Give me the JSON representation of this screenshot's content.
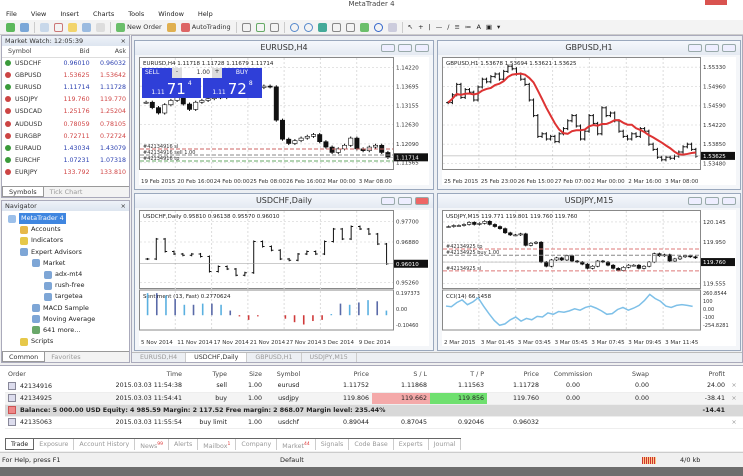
{
  "window": {
    "title": "MetaTrader 4"
  },
  "menu": [
    "File",
    "View",
    "Insert",
    "Charts",
    "Tools",
    "Window",
    "Help"
  ],
  "toolbar": {
    "new_order": "New Order",
    "autotrading": "AutoTrading"
  },
  "market_watch": {
    "title": "Market Watch: 12:05:39",
    "columns": [
      "Symbol",
      "Bid",
      "Ask"
    ],
    "rows": [
      {
        "symbol": "USDCHF",
        "bid": "0.96010",
        "ask": "0.96032",
        "dir": "up"
      },
      {
        "symbol": "GBPUSD",
        "bid": "1.53625",
        "ask": "1.53642",
        "dir": "dn"
      },
      {
        "symbol": "EURUSD",
        "bid": "1.11714",
        "ask": "1.11728",
        "dir": "up"
      },
      {
        "symbol": "USDJPY",
        "bid": "119.760",
        "ask": "119.770",
        "dir": "dn"
      },
      {
        "symbol": "USDCAD",
        "bid": "1.25176",
        "ask": "1.25204",
        "dir": "dn"
      },
      {
        "symbol": "AUDUSD",
        "bid": "0.78059",
        "ask": "0.78105",
        "dir": "dn"
      },
      {
        "symbol": "EURGBP",
        "bid": "0.72711",
        "ask": "0.72724",
        "dir": "dn"
      },
      {
        "symbol": "EURAUD",
        "bid": "1.43034",
        "ask": "1.43079",
        "dir": "up"
      },
      {
        "symbol": "EURCHF",
        "bid": "1.07231",
        "ask": "1.07318",
        "dir": "up"
      },
      {
        "symbol": "EURJPY",
        "bid": "133.792",
        "ask": "133.810",
        "dir": "dn"
      }
    ],
    "tabs": [
      "Symbols",
      "Tick Chart"
    ]
  },
  "navigator": {
    "title": "Navigator",
    "items": [
      {
        "label": "MetaTrader 4",
        "level": 0,
        "selected": true
      },
      {
        "label": "Accounts",
        "level": 1
      },
      {
        "label": "Indicators",
        "level": 1
      },
      {
        "label": "Expert Advisors",
        "level": 1
      },
      {
        "label": "Market",
        "level": 2
      },
      {
        "label": "adx-mt4",
        "level": 3
      },
      {
        "label": "rush-free",
        "level": 3
      },
      {
        "label": "targetea",
        "level": 3
      },
      {
        "label": "MACD Sample",
        "level": 2
      },
      {
        "label": "Moving Average",
        "level": 2
      },
      {
        "label": "641 more...",
        "level": 2
      },
      {
        "label": "Scripts",
        "level": 1
      }
    ],
    "tabs": [
      "Common",
      "Favorites"
    ]
  },
  "charts": {
    "eurusd": {
      "title": "EURUSD,H4",
      "info": "EURUSD,H4  1.11718 1.11728 1.11679 1.11714",
      "type": "candle",
      "ylim": [
        1.115,
        1.144
      ],
      "yticks": [
        "1.14220",
        "1.13695",
        "1.13155",
        "1.12630",
        "1.12090",
        "1.11565"
      ],
      "current": "1.11714",
      "xticks": [
        "19 Feb 2015",
        "20 Feb 16:00",
        "24 Feb 00:00",
        "25 Feb 08:00",
        "26 Feb 16:00",
        "2 Mar 00:00",
        "3 Mar 08:00"
      ],
      "closes": [
        1.1325,
        1.131,
        1.1295,
        1.1318,
        1.133,
        1.1345,
        1.132,
        1.1305,
        1.1325,
        1.133,
        1.1335,
        1.134,
        1.1338,
        1.1345,
        1.135,
        1.1362,
        1.1365,
        1.1368,
        1.1366,
        1.137,
        1.1368,
        1.1275,
        1.1222,
        1.121,
        1.1218,
        1.1225,
        1.123,
        1.1235,
        1.1215,
        1.12,
        1.1185,
        1.1195,
        1.1205,
        1.1225,
        1.1195,
        1.119,
        1.12,
        1.1205,
        1.1185,
        1.1171
      ],
      "order_lines": [
        "#42134916 sl",
        "#42134916 sell 1.00",
        "#42134916 tp"
      ],
      "trade_panel": {
        "sell": "SELL",
        "buy": "BUY",
        "lot": "1.00",
        "sell_big": "1.11",
        "sell_pips": "71",
        "sell_frac": "4",
        "buy_big": "1.11",
        "buy_pips": "72",
        "buy_frac": "8"
      }
    },
    "gbpusd": {
      "title": "GBPUSD,H1",
      "info": "GBPUSD,H1  1.53678 1.53694 1.53621 1.53625",
      "type": "bar",
      "ma": true,
      "ylim": [
        1.5345,
        1.5545
      ],
      "yticks": [
        "1.55330",
        "1.54960",
        "1.54590",
        "1.54220",
        "1.53850",
        "1.53480"
      ],
      "current": "1.53625",
      "xticks": [
        "25 Feb 2015",
        "25 Feb 23:00",
        "26 Feb 15:00",
        "27 Feb 07:00",
        "2 Mar 00:00",
        "2 Mar 16:00",
        "3 Mar 08:00"
      ],
      "closes": [
        1.5465,
        1.548,
        1.55,
        1.5475,
        1.549,
        1.5485,
        1.547,
        1.5495,
        1.551,
        1.5505,
        1.5515,
        1.552,
        1.551,
        1.5525,
        1.5535,
        1.553,
        1.552,
        1.551,
        1.55,
        1.547,
        1.544,
        1.54,
        1.5405,
        1.5395,
        1.54,
        1.539,
        1.5405,
        1.5415,
        1.543,
        1.544,
        1.542,
        1.5395,
        1.541,
        1.544,
        1.5425,
        1.5405,
        1.5455,
        1.544,
        1.5445,
        1.543,
        1.541,
        1.54,
        1.5395,
        1.5405,
        1.54,
        1.5415,
        1.541,
        1.5385,
        1.5375,
        1.536,
        1.5355,
        1.536,
        1.5358,
        1.5362,
        1.537,
        1.538,
        1.5385,
        1.5375,
        1.5362
      ]
    },
    "usdchf": {
      "title": "USDCHF,Daily",
      "info": "USDCHF,Daily  0.95810 0.96138 0.95570 0.96010",
      "type": "bar",
      "ylim": [
        0.952,
        0.98
      ],
      "yticks": [
        "0.97700",
        "0.96880",
        "0.95260"
      ],
      "current": "0.96010",
      "xticks": [
        "5 Nov 2014",
        "11 Nov 2014",
        "17 Nov 2014",
        "21 Nov 2014",
        "27 Nov 2014",
        "3 Dec 2014",
        "9 Dec 2014"
      ],
      "closes": [
        0.962,
        0.97,
        0.965,
        0.964,
        0.9635,
        0.964,
        0.963,
        0.957,
        0.959,
        0.958,
        0.9555,
        0.9565,
        0.969,
        0.967,
        0.9655,
        0.962,
        0.9615,
        0.964,
        0.965,
        0.964,
        0.969,
        0.974,
        0.97,
        0.975,
        0.974,
        0.972,
        0.968,
        0.9601
      ],
      "sub": {
        "label": "Sentiment (13, Fast) 0.2770624",
        "yticks": [
          "0.197373",
          "0.00",
          "-0.10460"
        ],
        "ylim": [
          -0.11,
          0.2
        ],
        "values": [
          0.19,
          0.19,
          0.17,
          0.14,
          0.09,
          0.09,
          0.1,
          0.1,
          0.09,
          0.04,
          -0.01,
          -0.04,
          -0.01,
          0,
          0,
          -0.03,
          -0.06,
          -0.08,
          -0.05,
          -0.04,
          0.01,
          0.1,
          0.09,
          0.11,
          0.13,
          0.12,
          0.04
        ]
      }
    },
    "usdjpy": {
      "title": "USDJPY,M15",
      "info": "USDJPY,M15  119.771 119.801 119.760 119.760",
      "type": "candle",
      "ylim": [
        119.55,
        120.22
      ],
      "yticks": [
        "120.145",
        "119.950",
        "119.760",
        "119.555"
      ],
      "current": "119.760",
      "xticks": [
        "2 Mar 2015",
        "3 Mar 01:45",
        "3 Mar 03:45",
        "3 Mar 05:45",
        "3 Mar 07:45",
        "3 Mar 09:45",
        "3 Mar 11:45"
      ],
      "closes": [
        120.1,
        120.11,
        120.11,
        120.12,
        120.14,
        120.12,
        120.13,
        120.15,
        120.12,
        120.1,
        120.08,
        120.04,
        120.02,
        120.02,
        120.03,
        119.92,
        119.94,
        119.95,
        119.76,
        119.72,
        119.78,
        119.8,
        119.78,
        119.82,
        119.77,
        119.76,
        119.74,
        119.7,
        119.72,
        119.77,
        119.76,
        119.73,
        119.7,
        119.68,
        119.71,
        119.73,
        119.73,
        119.7,
        119.72,
        119.76,
        119.84,
        119.82,
        119.83,
        119.77,
        119.79,
        119.81,
        119.82,
        119.81,
        119.8
      ],
      "order_lines": [
        "#42134925 tp",
        "#42134925 buy 1.00",
        "#42134925 sl"
      ],
      "sub": {
        "label": "CCI(14) 66.1458",
        "line": true,
        "yticks": [
          "260.8544",
          "100",
          "0.00",
          "-100",
          "-254.8281"
        ],
        "ylim": [
          -260,
          265
        ],
        "values": [
          60,
          50,
          110,
          150,
          80,
          120,
          180,
          60,
          -50,
          -150,
          -220,
          -200,
          -140,
          -100,
          -160,
          -120,
          -140,
          -90,
          -100,
          -40,
          -60,
          -20,
          -30,
          -10,
          20,
          0,
          40,
          60,
          30,
          -10,
          -60,
          -50,
          10,
          40,
          0,
          30,
          70,
          140,
          230,
          170,
          130,
          60,
          40,
          70,
          80,
          70,
          55
        ]
      }
    }
  },
  "chart_tabs": [
    "EURUSD,H4",
    "USDCHF,Daily",
    "GBPUSD,H1",
    "USDJPY,M15"
  ],
  "terminal": {
    "columns": [
      "Order",
      "Time",
      "Type",
      "Size",
      "Symbol",
      "Price",
      "S / L",
      "T / P",
      "Price",
      "Commission",
      "Swap",
      "Profit"
    ],
    "rows": [
      {
        "order": "42134916",
        "time": "2015.03.03 11:54:38",
        "type": "sell",
        "size": "1.00",
        "symbol": "eurusd",
        "price": "1.11752",
        "sl": "1.11868",
        "tp": "1.11563",
        "cur": "1.11728",
        "commission": "0.00",
        "swap": "0.00",
        "profit": "24.00"
      },
      {
        "order": "42134925",
        "time": "2015.03.03 11:54:41",
        "type": "buy",
        "size": "1.00",
        "symbol": "usdjpy",
        "price": "119.806",
        "sl": "119.662",
        "tp": "119.856",
        "cur": "119.760",
        "commission": "0.00",
        "swap": "0.00",
        "profit": "-38.41"
      }
    ],
    "balance": "Balance: 5 000.00 USD  Equity: 4 985.59  Margin: 2 117.52  Free margin: 2 868.07  Margin level: 235.44%",
    "balance_profit": "-14.41",
    "pending": {
      "order": "42135063",
      "time": "2015.03.03 11:55:54",
      "type": "buy limit",
      "size": "1.00",
      "symbol": "usdchf",
      "price": "0.89044",
      "sl": "0.87045",
      "tp": "0.92046",
      "cur": "0.96032"
    },
    "tabs": [
      {
        "label": "Trade"
      },
      {
        "label": "Exposure"
      },
      {
        "label": "Account History"
      },
      {
        "label": "News",
        "badge": "99"
      },
      {
        "label": "Alerts"
      },
      {
        "label": "Mailbox",
        "badge": "1"
      },
      {
        "label": "Company"
      },
      {
        "label": "Market",
        "badge": "44"
      },
      {
        "label": "Signals"
      },
      {
        "label": "Code Base"
      },
      {
        "label": "Experts"
      },
      {
        "label": "Journal"
      }
    ],
    "colors": {
      "sl_bg": "#f4a9a9",
      "tp_bg": "#6fe06f"
    }
  },
  "status": {
    "help": "For Help, press F1",
    "profile": "Default",
    "traffic": "4/0 kb"
  }
}
